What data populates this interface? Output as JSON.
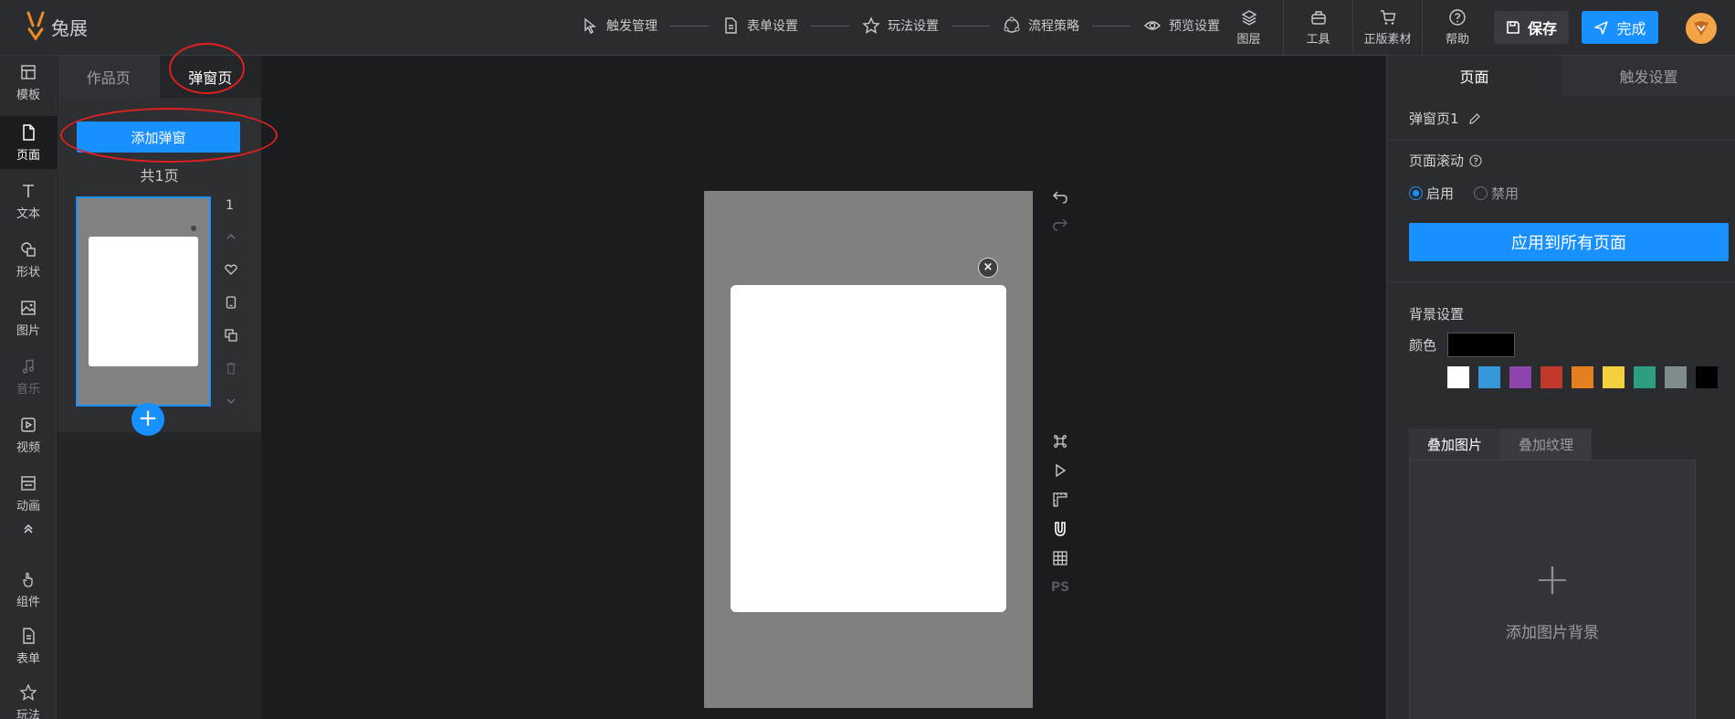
{
  "brand": {
    "name": "兔展"
  },
  "steps": [
    "触发管理",
    "表单设置",
    "玩法设置",
    "流程策略",
    "预览设置"
  ],
  "tools": [
    "图层",
    "工具",
    "正版素材",
    "帮助"
  ],
  "actions": {
    "save": "保存",
    "done": "完成"
  },
  "rail": [
    "模板",
    "页面",
    "文本",
    "形状",
    "图片",
    "音乐",
    "视频",
    "动画",
    "组件",
    "表单",
    "玩法"
  ],
  "page_panel": {
    "tabs": [
      "作品页",
      "弹窗页"
    ],
    "add_popup": "添加弹窗",
    "count": "共1页",
    "thumb_number": "1"
  },
  "canvas": {
    "close_glyph": "×",
    "ps_label": "PS"
  },
  "right_panel": {
    "tabs": [
      "页面",
      "触发设置"
    ],
    "page_name": "弹窗页1",
    "scroll_label": "页面滚动",
    "radio_on": "启用",
    "radio_off": "禁用",
    "apply": "应用到所有页面",
    "bg_title": "背景设置",
    "color_label": "颜色",
    "current_color": "#000000",
    "swatches": [
      "#ffffff",
      "#3498db",
      "#8e44ad",
      "#c0392b",
      "#e67e22",
      "#f4d03f",
      "#2e9e80",
      "#7f8c8d",
      "#000000"
    ],
    "overlay_tabs": [
      "叠加图片",
      "叠加纹理"
    ],
    "overlay_add": "添加图片背景"
  },
  "colors": {
    "accent": "#1890ff",
    "annotation": "#e02020"
  }
}
